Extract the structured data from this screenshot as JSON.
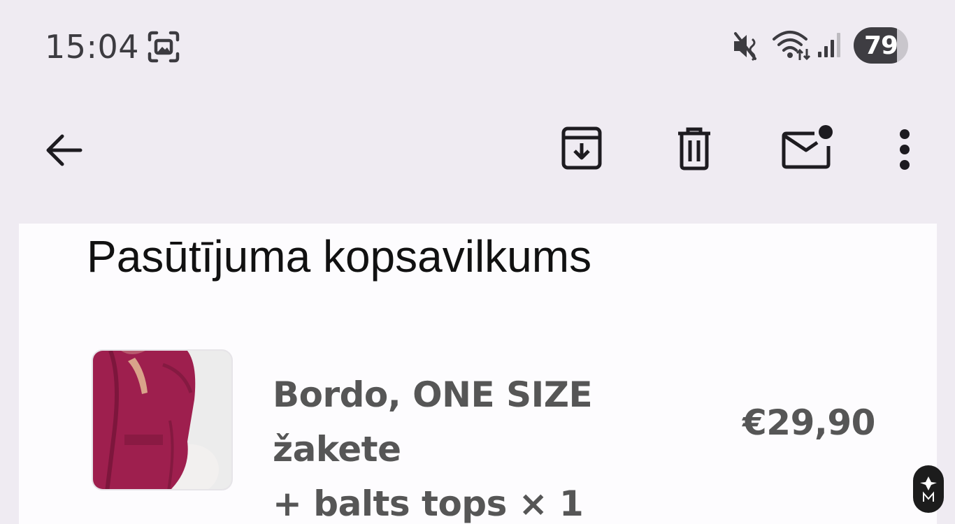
{
  "status_bar": {
    "time": "15:04",
    "battery_level": "79",
    "battery_fraction": 0.79,
    "icons": [
      "screenshot-icon",
      "mute-icon",
      "wifi-icon",
      "signal-icon"
    ]
  },
  "toolbar": {
    "back": "arrow-back-icon",
    "archive": "archive-icon",
    "delete": "trash-icon",
    "mark_unread": "mail-unread-icon",
    "more": "more-vert-icon"
  },
  "email": {
    "summary_title": "Pasūtījuma kopsavilkums",
    "product": {
      "name_line1": "Bordo, ONE SIZE žakete",
      "name_line2": "+ balts tops × 1",
      "price": "€29,90",
      "image": "product-photo-burgundy-jacket"
    }
  },
  "colors": {
    "background": "#efebf2",
    "card": "#fdfcfe",
    "icon": "#1d1b20",
    "text_dark": "#111111",
    "text_muted": "#565656",
    "jacket": "#9e1f4e"
  }
}
